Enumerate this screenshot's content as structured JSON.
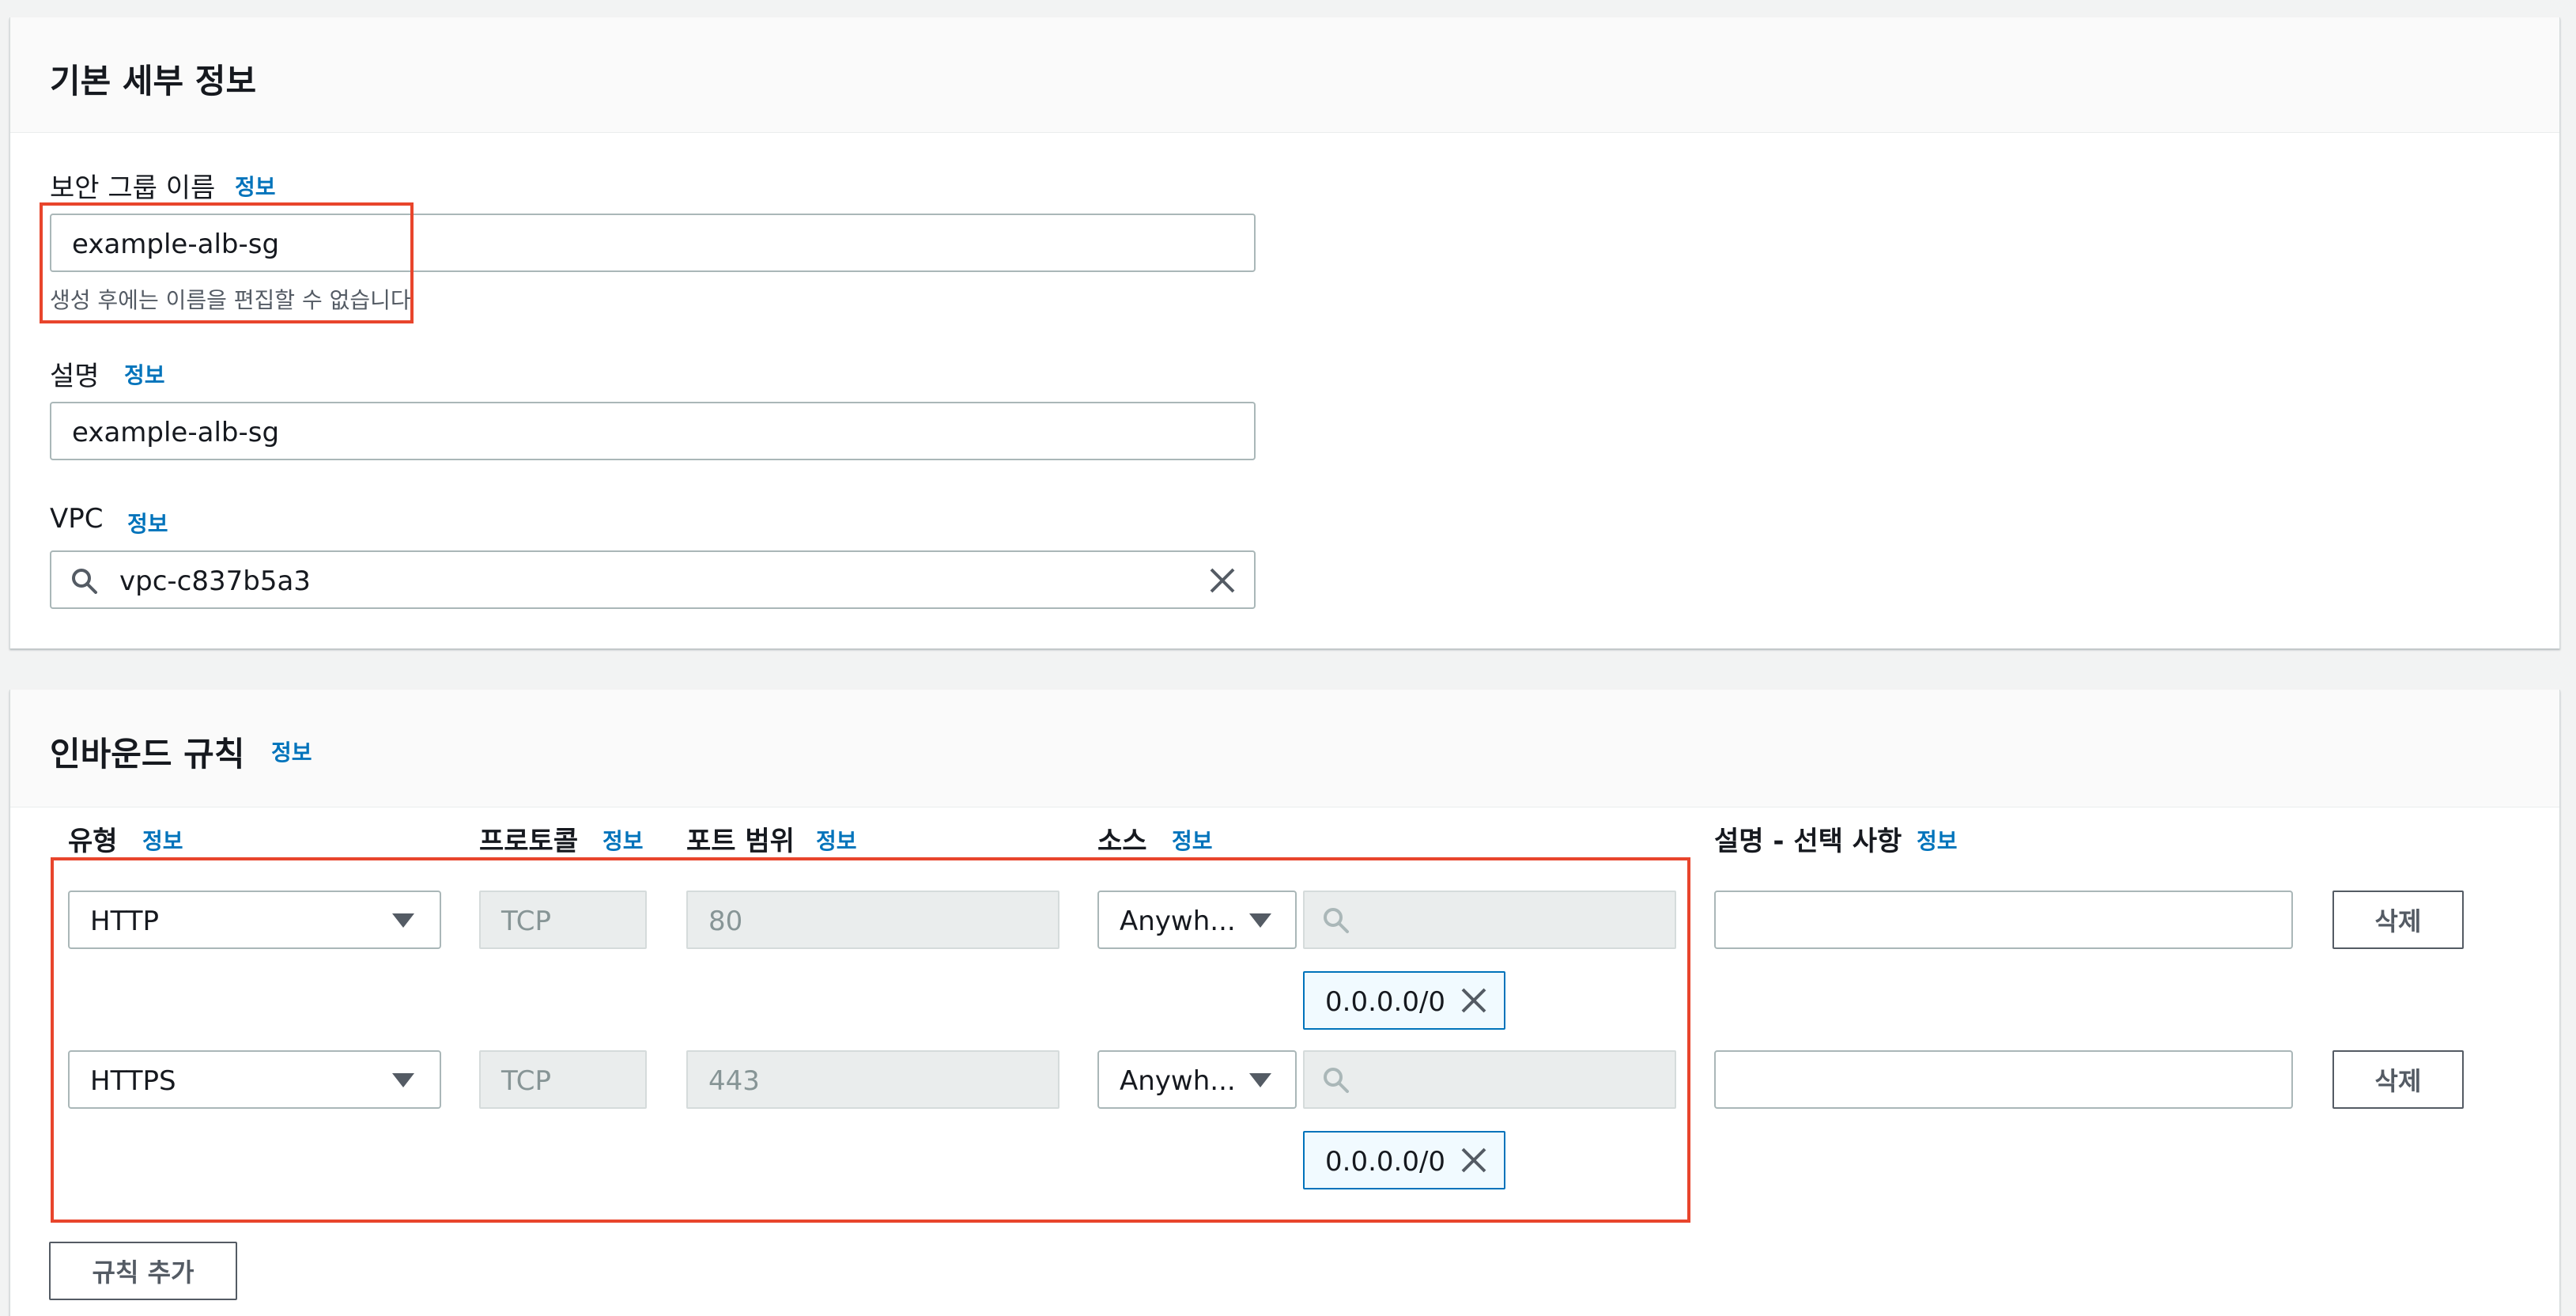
{
  "basic": {
    "title": "기본 세부 정보",
    "sg_name_label": "보안 그룹 이름",
    "info": "정보",
    "sg_name_value": "example-alb-sg",
    "sg_name_hint": "생성 후에는 이름을 편집할 수 없습니다",
    "desc_label": "설명",
    "desc_value": "example-alb-sg",
    "vpc_label": "VPC",
    "vpc_value": "vpc-c837b5a3"
  },
  "inbound": {
    "title": "인바운드 규칙",
    "info": "정보",
    "col_type": "유형",
    "col_protocol": "프로토콜",
    "col_port": "포트 범위",
    "col_source": "소스",
    "col_desc": "설명 - 선택 사항",
    "rules": [
      {
        "type": "HTTP",
        "protocol": "TCP",
        "port": "80",
        "source_type": "Anywh...",
        "cidr": "0.0.0.0/0",
        "delete_label": "삭제"
      },
      {
        "type": "HTTPS",
        "protocol": "TCP",
        "port": "443",
        "source_type": "Anywh...",
        "cidr": "0.0.0.0/0",
        "delete_label": "삭제"
      }
    ],
    "add_rule_label": "규칙 추가"
  },
  "colors": {
    "link": "#0073bb",
    "highlight": "#e8452c",
    "border": "#aab7b8"
  },
  "icons": [
    "search-icon",
    "clear-icon",
    "caret-down-icon",
    "remove-token-icon"
  ]
}
